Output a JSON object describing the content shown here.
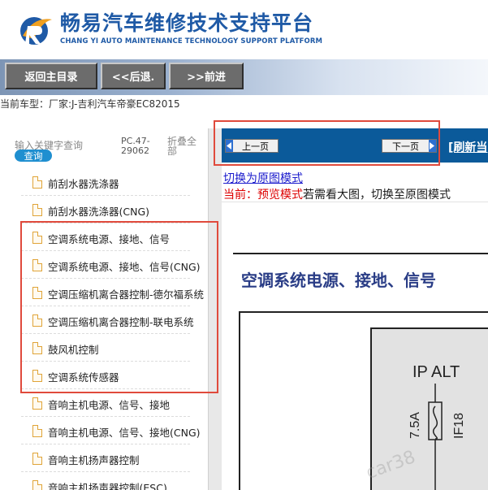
{
  "header": {
    "title_cn": "畅易汽车维修技术支持平台",
    "title_en": "CHANG YI AUTO MAINTENANCE TECHNOLOGY SUPPORT PLATFORM",
    "brand_color": "#1f5aa6",
    "logo_icon": "chang-yi-logo-icon"
  },
  "nav": {
    "home_label": "返回主目录",
    "back_label": "<<后退.",
    "forward_label": ">>前进"
  },
  "vehicle": {
    "text": "当前车型：厂家:J-吉利汽车帝豪EC82015"
  },
  "sidebar": {
    "search_placeholder": "输入关键字查询",
    "query_label": "查询",
    "pc_code": "PC.47-29062",
    "fold_all_label": "折叠全部",
    "items": [
      {
        "label": "前刮水器洗涤器"
      },
      {
        "label": "前刮水器洗涤器(CNG)"
      },
      {
        "label": "空调系统电源、接地、信号"
      },
      {
        "label": "空调系统电源、接地、信号(CNG)"
      },
      {
        "label": "空调压缩机离合器控制-德尔福系统"
      },
      {
        "label": "空调压缩机离合器控制-联电系统"
      },
      {
        "label": "鼓风机控制"
      },
      {
        "label": "空调系统传感器"
      },
      {
        "label": "音响主机电源、信号、接地"
      },
      {
        "label": "音响主机电源、信号、接地(CNG)"
      },
      {
        "label": "音响主机扬声器控制"
      },
      {
        "label": "音响主机扬声器控制(ESC)"
      }
    ]
  },
  "pager": {
    "prev_label": "上一页",
    "next_label": "下一页",
    "refresh_label": "[刷新当",
    "bar_color": "#0b5a9a"
  },
  "view_mode": {
    "switch_link": "切换为原图模式",
    "current_prefix": "当前：",
    "current_mode": "预览模式",
    "hint": "若需看大图，切换至原图模式"
  },
  "document": {
    "title": "空调系统电源、接地、信号",
    "fuse_label": "IP ALT",
    "fuse_rating": "7.5A",
    "fuse_id": "IF18",
    "watermark": "car38"
  },
  "annotation_color": "#e04a3c"
}
